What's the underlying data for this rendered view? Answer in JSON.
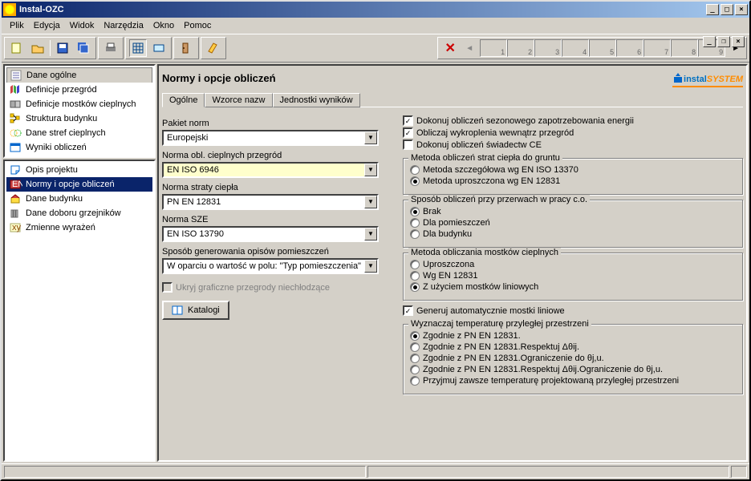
{
  "window": {
    "title": "Instal-OZC"
  },
  "menu": [
    "Plik",
    "Edycja",
    "Widok",
    "Narzędzia",
    "Okno",
    "Pomoc"
  ],
  "nav_numbers": [
    "1",
    "2",
    "3",
    "4",
    "5",
    "6",
    "7",
    "8",
    "9"
  ],
  "sidebar_top": [
    {
      "label": "Dane ogólne",
      "active": true
    },
    {
      "label": "Definicje przegród"
    },
    {
      "label": "Definicje mostków cieplnych"
    },
    {
      "label": "Struktura budynku"
    },
    {
      "label": "Dane stref cieplnych"
    },
    {
      "label": "Wyniki obliczeń"
    }
  ],
  "sidebar_bottom": [
    {
      "label": "Opis projektu"
    },
    {
      "label": "Normy i opcje obliczeń",
      "selected": true
    },
    {
      "label": "Dane budynku"
    },
    {
      "label": "Dane doboru grzejników"
    },
    {
      "label": "Zmienne wyrażeń"
    }
  ],
  "main": {
    "title": "Normy i opcje obliczeń",
    "brand_prefix": "instal",
    "brand_suffix": "SYSTEM",
    "tabs": [
      "Ogólne",
      "Wzorce nazw",
      "Jednostki wyników"
    ],
    "left": {
      "pakiet_label": "Pakiet norm",
      "pakiet_value": "Europejski",
      "norma_cieplnych_label": "Norma obl. cieplnych przegród",
      "norma_cieplnych_value": "EN ISO 6946",
      "norma_straty_label": "Norma straty ciepła",
      "norma_straty_value": "PN EN 12831",
      "norma_sze_label": "Norma SZE",
      "norma_sze_value": "EN ISO 13790",
      "sposob_label": "Sposób generowania opisów pomieszczeń",
      "sposob_value": "W oparciu o wartość w polu: \"Typ pomieszczenia\"",
      "hide_label": "Ukryj graficzne przegrody niechłodzące",
      "katalogi": "Katalogi"
    },
    "right": {
      "cb1": "Dokonuj obliczeń sezonowego zapotrzebowania energii",
      "cb2": "Obliczaj wykroplenia wewnątrz przegród",
      "cb3": "Dokonuj obliczeń świadectw CE",
      "g1_title": "Metoda obliczeń strat ciepła do gruntu",
      "g1_r1": "Metoda szczegółowa wg EN ISO 13370",
      "g1_r2": "Metoda uproszczona wg EN 12831",
      "g2_title": "Sposób obliczeń przy przerwach w pracy c.o.",
      "g2_r1": "Brak",
      "g2_r2": "Dla pomieszczeń",
      "g2_r3": "Dla budynku",
      "g3_title": "Metoda obliczania mostków cieplnych",
      "g3_r1": "Uproszczona",
      "g3_r2": "Wg EN 12831",
      "g3_r3": "Z użyciem mostków liniowych",
      "cb4": "Generuj automatycznie mostki liniowe",
      "g4_title": "Wyznaczaj temperaturę przyległej przestrzeni",
      "g4_r1": "Zgodnie z PN EN 12831.",
      "g4_r2": "Zgodnie z PN EN 12831.Respektuj Δθij.",
      "g4_r3": "Zgodnie z PN EN 12831.Ograniczenie do θj,u.",
      "g4_r4": "Zgodnie z PN EN 12831.Respektuj Δθij.Ograniczenie do θj,u.",
      "g4_r5": "Przyjmuj zawsze temperaturę projektowaną przyległej przestrzeni"
    }
  }
}
